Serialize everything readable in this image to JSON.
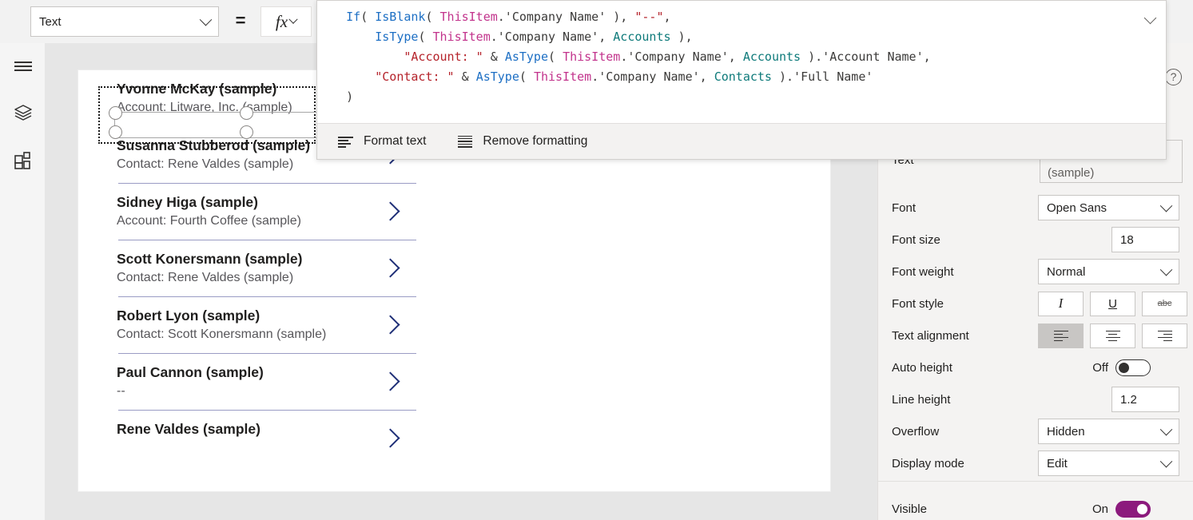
{
  "toolbar": {
    "property_selected": "Text",
    "equals_sign": "=",
    "fx_label": "fx",
    "chevron_icon": "chevron-down-icon"
  },
  "formula": {
    "lines": [
      [
        {
          "t": "    ",
          "c": "pln"
        },
        {
          "t": "If",
          "c": "fn"
        },
        {
          "t": "( ",
          "c": "pln"
        },
        {
          "t": "IsBlank",
          "c": "fn"
        },
        {
          "t": "( ",
          "c": "pln"
        },
        {
          "t": "ThisItem",
          "c": "var"
        },
        {
          "t": ".'Company Name' ), ",
          "c": "pln"
        },
        {
          "t": "\"--\"",
          "c": "str"
        },
        {
          "t": ",",
          "c": "pln"
        }
      ],
      [
        {
          "t": "        ",
          "c": "pln"
        },
        {
          "t": "IsType",
          "c": "fn"
        },
        {
          "t": "( ",
          "c": "pln"
        },
        {
          "t": "ThisItem",
          "c": "var"
        },
        {
          "t": ".'Company Name', ",
          "c": "pln"
        },
        {
          "t": "Accounts",
          "c": "ds"
        },
        {
          "t": " ),",
          "c": "pln"
        }
      ],
      [
        {
          "t": "            ",
          "c": "pln"
        },
        {
          "t": "\"Account: \"",
          "c": "str"
        },
        {
          "t": " & ",
          "c": "pln"
        },
        {
          "t": "AsType",
          "c": "fn"
        },
        {
          "t": "( ",
          "c": "pln"
        },
        {
          "t": "ThisItem",
          "c": "var"
        },
        {
          "t": ".'Company Name', ",
          "c": "pln"
        },
        {
          "t": "Accounts",
          "c": "ds"
        },
        {
          "t": " ).'Account Name',",
          "c": "pln"
        }
      ],
      [
        {
          "t": "        ",
          "c": "pln"
        },
        {
          "t": "\"Contact: \"",
          "c": "str"
        },
        {
          "t": " & ",
          "c": "pln"
        },
        {
          "t": "AsType",
          "c": "fn"
        },
        {
          "t": "( ",
          "c": "pln"
        },
        {
          "t": "ThisItem",
          "c": "var"
        },
        {
          "t": ".'Company Name', ",
          "c": "pln"
        },
        {
          "t": "Contacts",
          "c": "ds"
        },
        {
          "t": " ).'Full Name'",
          "c": "pln"
        }
      ],
      [
        {
          "t": "    )",
          "c": "pln"
        }
      ]
    ],
    "collapse_icon": "chevron-up-icon",
    "footer": {
      "format_text": "Format text",
      "remove_formatting": "Remove formatting",
      "format_text_icon": "format-text-icon",
      "remove_formatting_icon": "remove-formatting-icon"
    }
  },
  "left_rail": {
    "items": [
      {
        "icon": "hamburger-menu-icon",
        "name": "menu"
      },
      {
        "icon": "layers-tree-view-icon",
        "name": "tree-view"
      },
      {
        "icon": "insert-components-icon",
        "name": "insert"
      }
    ]
  },
  "gallery": {
    "items": [
      {
        "title": "Yvonne McKay (sample)",
        "subtitle": "Account: Litware, Inc. (sample)",
        "selected": true,
        "show_chevron": false,
        "show_separator": false
      },
      {
        "title": "Susanna Stubberod (sample)",
        "subtitle": "Contact: Rene Valdes (sample)",
        "selected": false,
        "show_chevron": true,
        "show_separator": true
      },
      {
        "title": "Sidney Higa (sample)",
        "subtitle": "Account: Fourth Coffee (sample)",
        "selected": false,
        "show_chevron": true,
        "show_separator": true
      },
      {
        "title": "Scott Konersmann (sample)",
        "subtitle": "Contact: Rene Valdes (sample)",
        "selected": false,
        "show_chevron": true,
        "show_separator": true
      },
      {
        "title": "Robert Lyon (sample)",
        "subtitle": "Contact: Scott Konersmann (sample)",
        "selected": false,
        "show_chevron": true,
        "show_separator": true
      },
      {
        "title": "Paul Cannon (sample)",
        "subtitle": "--",
        "selected": false,
        "show_chevron": true,
        "show_separator": true
      },
      {
        "title": "Rene Valdes (sample)",
        "subtitle": "",
        "selected": false,
        "show_chevron": true,
        "show_separator": false
      }
    ],
    "chevron_icon": "chevron-right-icon"
  },
  "properties": {
    "help_icon": "help-question-icon",
    "text": {
      "label": "Text",
      "value": "Account: Litware, Inc. (sample)"
    },
    "font": {
      "label": "Font",
      "value": "Open Sans"
    },
    "font_size": {
      "label": "Font size",
      "value": "18"
    },
    "font_weight": {
      "label": "Font weight",
      "value": "Normal"
    },
    "font_style": {
      "label": "Font style",
      "buttons": [
        {
          "name": "italic-button",
          "glyph": "I",
          "active": false
        },
        {
          "name": "underline-button",
          "glyph": "U",
          "active": false
        },
        {
          "name": "strikethrough-button",
          "glyph": "abc",
          "active": false
        }
      ]
    },
    "text_alignment": {
      "label": "Text alignment",
      "buttons": [
        {
          "name": "align-left-button",
          "active": true
        },
        {
          "name": "align-center-button",
          "active": false
        },
        {
          "name": "align-right-button",
          "active": false
        },
        {
          "name": "align-justify-button",
          "active": false
        }
      ]
    },
    "auto_height": {
      "label": "Auto height",
      "state": "Off",
      "on": false
    },
    "line_height": {
      "label": "Line height",
      "value": "1.2"
    },
    "overflow": {
      "label": "Overflow",
      "value": "Hidden"
    },
    "display_mode": {
      "label": "Display mode",
      "value": "Edit"
    },
    "visible": {
      "label": "Visible",
      "state": "On",
      "on": true
    }
  },
  "colors": {
    "accent_purple": "#8c1a7d",
    "chevron_navy": "#1f2f77",
    "separator_lavender": "#9a9cc4"
  }
}
